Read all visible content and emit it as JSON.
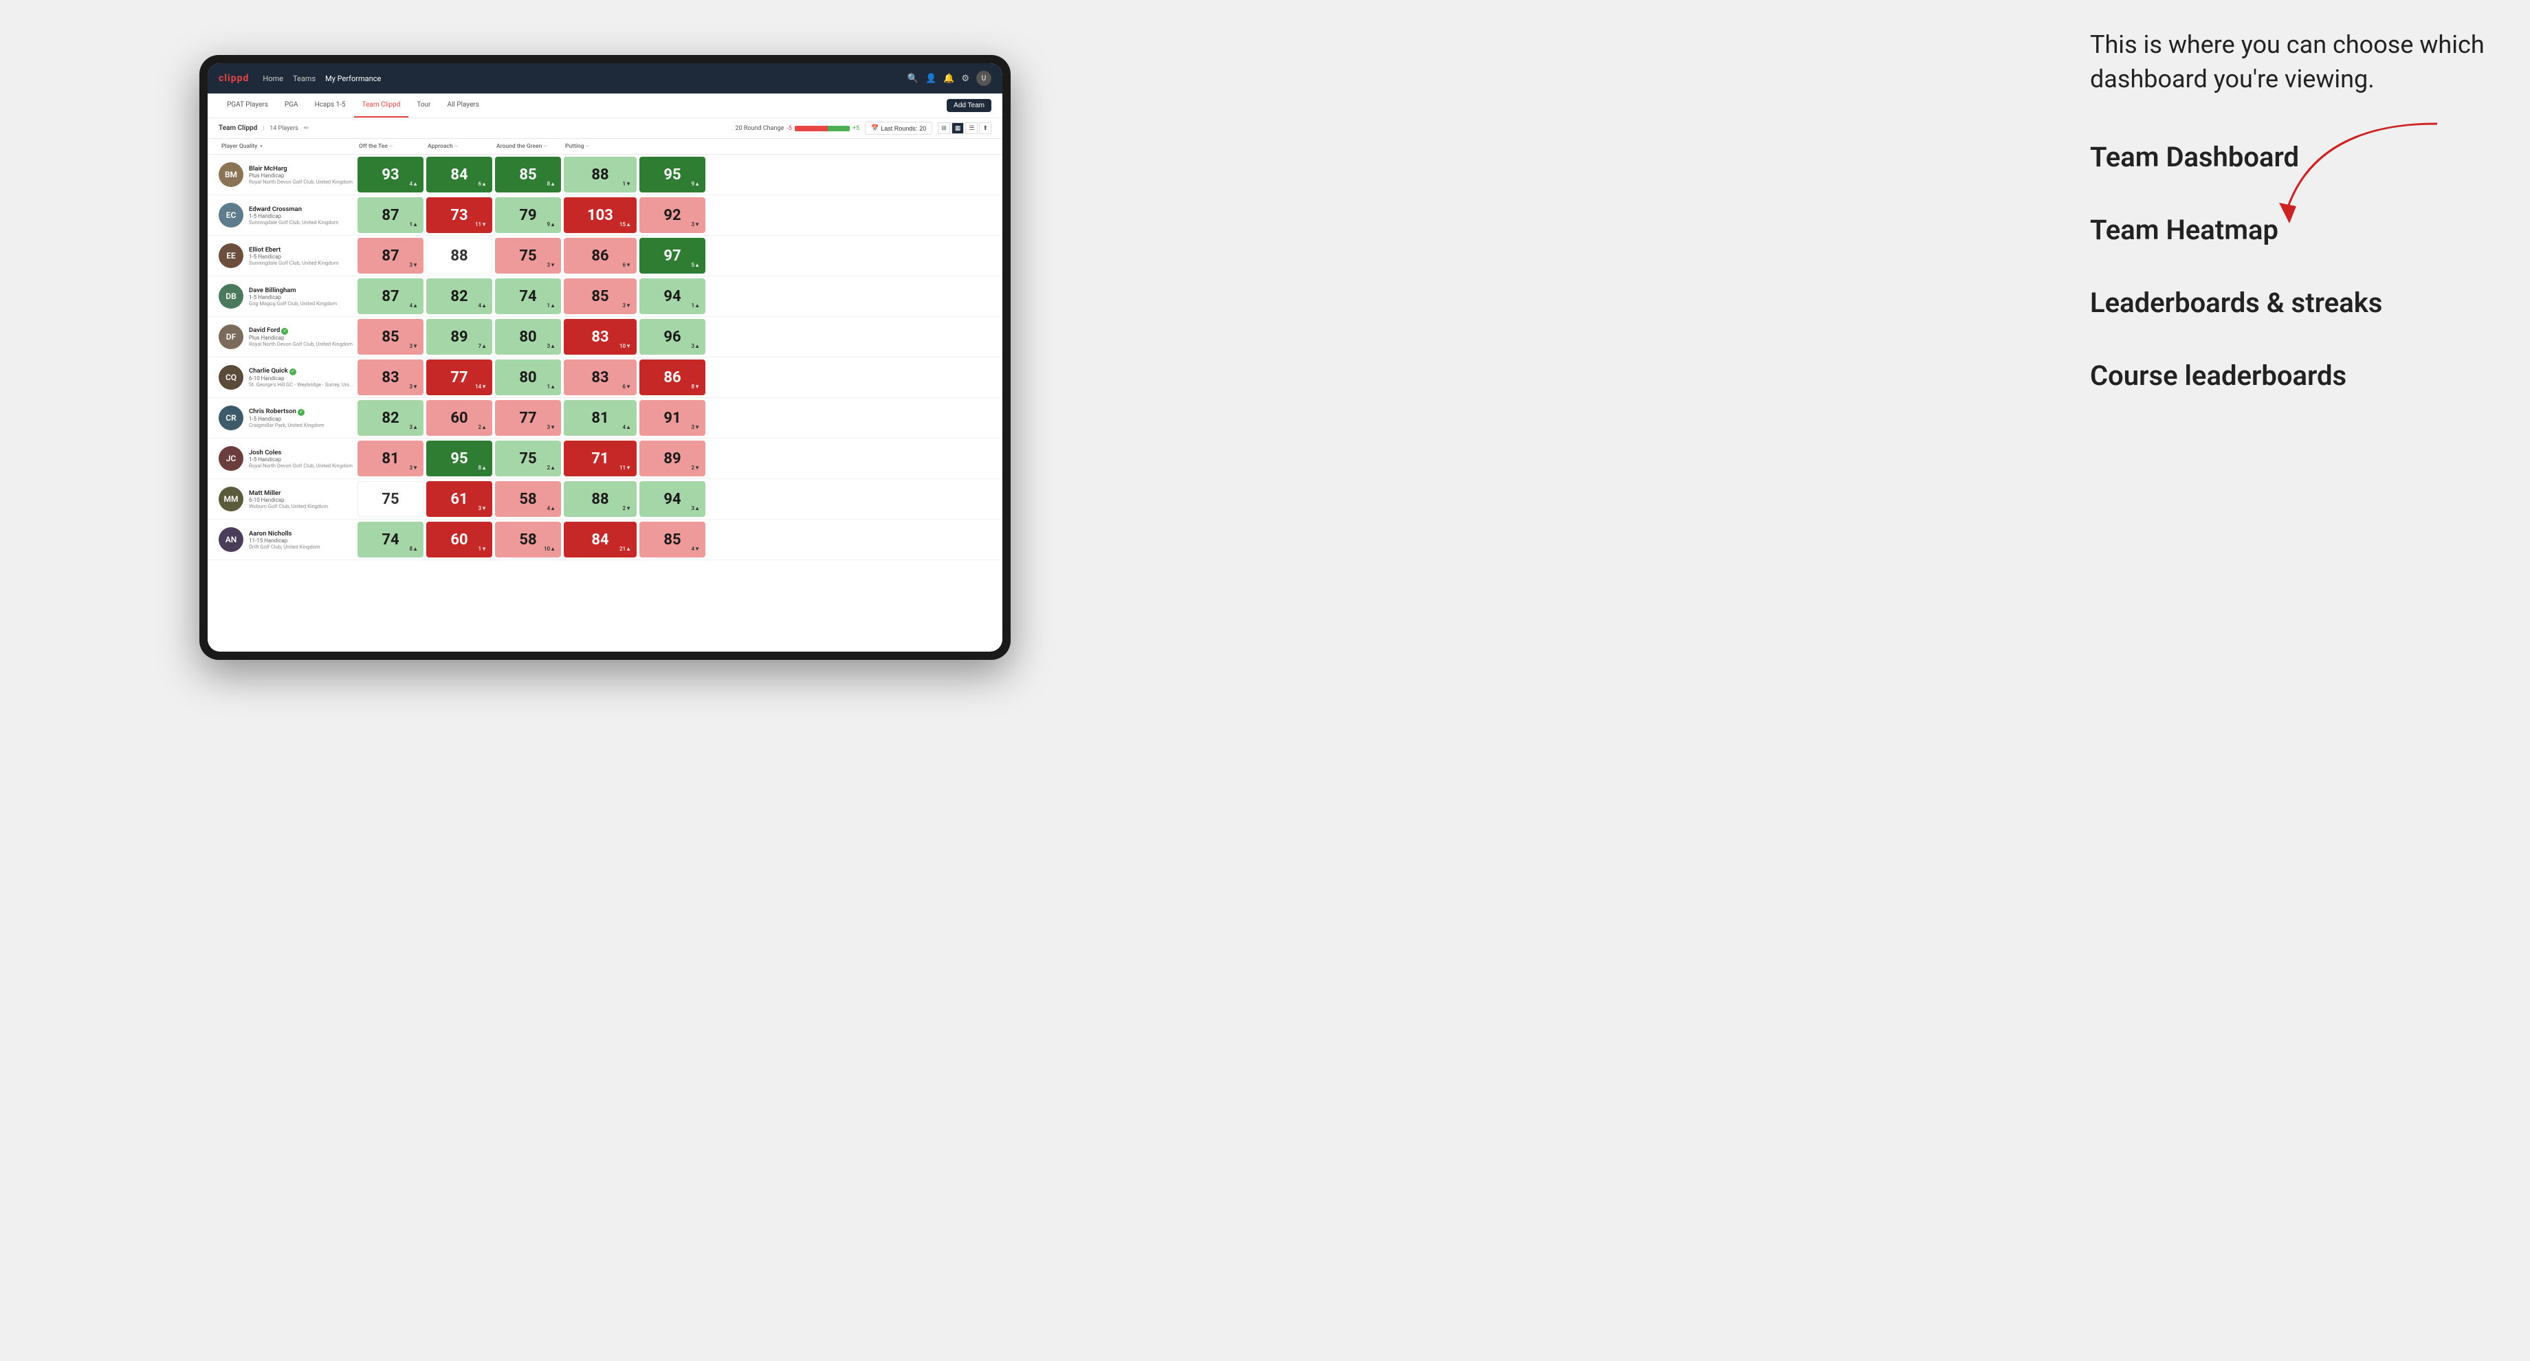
{
  "annotation": {
    "intro_text": "This is where you can choose which dashboard you're viewing.",
    "options": [
      {
        "label": "Team Dashboard"
      },
      {
        "label": "Team Heatmap"
      },
      {
        "label": "Leaderboards & streaks"
      },
      {
        "label": "Course leaderboards"
      }
    ]
  },
  "nav": {
    "logo": "clippd",
    "links": [
      "Home",
      "Teams",
      "My Performance"
    ],
    "active_link": "My Performance"
  },
  "tabs": {
    "items": [
      "PGAT Players",
      "PGA",
      "Hcaps 1-5",
      "Team Clippd",
      "Tour",
      "All Players"
    ],
    "active": "Team Clippd",
    "add_button": "Add Team"
  },
  "toolbar": {
    "team_name": "Team Clippd",
    "team_count": "14 Players",
    "round_change_label": "20 Round Change",
    "round_change_min": "-5",
    "round_change_max": "+5",
    "last_rounds_label": "Last Rounds:",
    "last_rounds_value": "20"
  },
  "columns": [
    {
      "label": "Player Quality",
      "sort": "▼"
    },
    {
      "label": "Off the Tee",
      "sort": "—"
    },
    {
      "label": "Approach",
      "sort": "—"
    },
    {
      "label": "Around the Green",
      "sort": "—"
    },
    {
      "label": "Putting",
      "sort": "—"
    }
  ],
  "players": [
    {
      "name": "Blair McHarg",
      "handicap": "Plus Handicap",
      "club": "Royal North Devon Golf Club, United Kingdom",
      "avatar_color": "#8B7355",
      "initials": "BM",
      "scores": [
        {
          "value": "93",
          "change": "4▲",
          "color": "green-dark"
        },
        {
          "value": "84",
          "change": "6▲",
          "color": "green-dark"
        },
        {
          "value": "85",
          "change": "8▲",
          "color": "green-dark"
        },
        {
          "value": "88",
          "change": "1▼",
          "color": "green-light"
        },
        {
          "value": "95",
          "change": "9▲",
          "color": "green-dark"
        }
      ]
    },
    {
      "name": "Edward Crossman",
      "handicap": "1-5 Handicap",
      "club": "Sunningdale Golf Club, United Kingdom",
      "avatar_color": "#5D7B8A",
      "initials": "EC",
      "scores": [
        {
          "value": "87",
          "change": "1▲",
          "color": "green-light"
        },
        {
          "value": "73",
          "change": "11▼",
          "color": "red-dark"
        },
        {
          "value": "79",
          "change": "9▲",
          "color": "green-light"
        },
        {
          "value": "103",
          "change": "15▲",
          "color": "red-dark"
        },
        {
          "value": "92",
          "change": "3▼",
          "color": "red-light"
        }
      ]
    },
    {
      "name": "Elliot Ebert",
      "handicap": "1-5 Handicap",
      "club": "Sunningdale Golf Club, United Kingdom",
      "avatar_color": "#6B4E3D",
      "initials": "EE",
      "scores": [
        {
          "value": "87",
          "change": "3▼",
          "color": "red-light"
        },
        {
          "value": "88",
          "change": "",
          "color": "white-bg"
        },
        {
          "value": "75",
          "change": "3▼",
          "color": "red-light"
        },
        {
          "value": "86",
          "change": "6▼",
          "color": "red-light"
        },
        {
          "value": "97",
          "change": "5▲",
          "color": "green-dark"
        }
      ]
    },
    {
      "name": "Dave Billingham",
      "handicap": "1-5 Handicap",
      "club": "Gog Magog Golf Club, United Kingdom",
      "avatar_color": "#4A7A5B",
      "initials": "DB",
      "scores": [
        {
          "value": "87",
          "change": "4▲",
          "color": "green-light"
        },
        {
          "value": "82",
          "change": "4▲",
          "color": "green-light"
        },
        {
          "value": "74",
          "change": "1▲",
          "color": "green-light"
        },
        {
          "value": "85",
          "change": "3▼",
          "color": "red-light"
        },
        {
          "value": "94",
          "change": "1▲",
          "color": "green-light"
        }
      ]
    },
    {
      "name": "David Ford",
      "handicap": "Plus Handicap",
      "club": "Royal North Devon Golf Club, United Kingdom",
      "avatar_color": "#7B6B5A",
      "initials": "DF",
      "verified": true,
      "scores": [
        {
          "value": "85",
          "change": "3▼",
          "color": "red-light"
        },
        {
          "value": "89",
          "change": "7▲",
          "color": "green-light"
        },
        {
          "value": "80",
          "change": "3▲",
          "color": "green-light"
        },
        {
          "value": "83",
          "change": "10▼",
          "color": "red-dark"
        },
        {
          "value": "96",
          "change": "3▲",
          "color": "green-light"
        }
      ]
    },
    {
      "name": "Charlie Quick",
      "handicap": "6-10 Handicap",
      "club": "St. George's Hill GC - Weybridge - Surrey, Uni...",
      "avatar_color": "#5A4A3A",
      "initials": "CQ",
      "verified": true,
      "scores": [
        {
          "value": "83",
          "change": "3▼",
          "color": "red-light"
        },
        {
          "value": "77",
          "change": "14▼",
          "color": "red-dark"
        },
        {
          "value": "80",
          "change": "1▲",
          "color": "green-light"
        },
        {
          "value": "83",
          "change": "6▼",
          "color": "red-light"
        },
        {
          "value": "86",
          "change": "8▼",
          "color": "red-dark"
        }
      ]
    },
    {
      "name": "Chris Robertson",
      "handicap": "1-5 Handicap",
      "club": "Craigmillar Park, United Kingdom",
      "avatar_color": "#3D5A6B",
      "initials": "CR",
      "verified": true,
      "scores": [
        {
          "value": "82",
          "change": "3▲",
          "color": "green-light"
        },
        {
          "value": "60",
          "change": "2▲",
          "color": "red-light"
        },
        {
          "value": "77",
          "change": "3▼",
          "color": "red-light"
        },
        {
          "value": "81",
          "change": "4▲",
          "color": "green-light"
        },
        {
          "value": "91",
          "change": "3▼",
          "color": "red-light"
        }
      ]
    },
    {
      "name": "Josh Coles",
      "handicap": "1-5 Handicap",
      "club": "Royal North Devon Golf Club, United Kingdom",
      "avatar_color": "#6B3D3D",
      "initials": "JC",
      "scores": [
        {
          "value": "81",
          "change": "3▼",
          "color": "red-light"
        },
        {
          "value": "95",
          "change": "8▲",
          "color": "green-dark"
        },
        {
          "value": "75",
          "change": "2▲",
          "color": "green-light"
        },
        {
          "value": "71",
          "change": "11▼",
          "color": "red-dark"
        },
        {
          "value": "89",
          "change": "2▼",
          "color": "red-light"
        }
      ]
    },
    {
      "name": "Matt Miller",
      "handicap": "6-10 Handicap",
      "club": "Woburn Golf Club, United Kingdom",
      "avatar_color": "#5A5A3D",
      "initials": "MM",
      "scores": [
        {
          "value": "75",
          "change": "",
          "color": "white-bg"
        },
        {
          "value": "61",
          "change": "3▼",
          "color": "red-dark"
        },
        {
          "value": "58",
          "change": "4▲",
          "color": "red-light"
        },
        {
          "value": "88",
          "change": "2▼",
          "color": "green-light"
        },
        {
          "value": "94",
          "change": "3▲",
          "color": "green-light"
        }
      ]
    },
    {
      "name": "Aaron Nicholls",
      "handicap": "11-15 Handicap",
      "club": "Drift Golf Club, United Kingdom",
      "avatar_color": "#4A3D5A",
      "initials": "AN",
      "scores": [
        {
          "value": "74",
          "change": "8▲",
          "color": "green-light"
        },
        {
          "value": "60",
          "change": "1▼",
          "color": "red-dark"
        },
        {
          "value": "58",
          "change": "10▲",
          "color": "red-light"
        },
        {
          "value": "84",
          "change": "21▲",
          "color": "red-dark"
        },
        {
          "value": "85",
          "change": "4▼",
          "color": "red-light"
        }
      ]
    }
  ]
}
